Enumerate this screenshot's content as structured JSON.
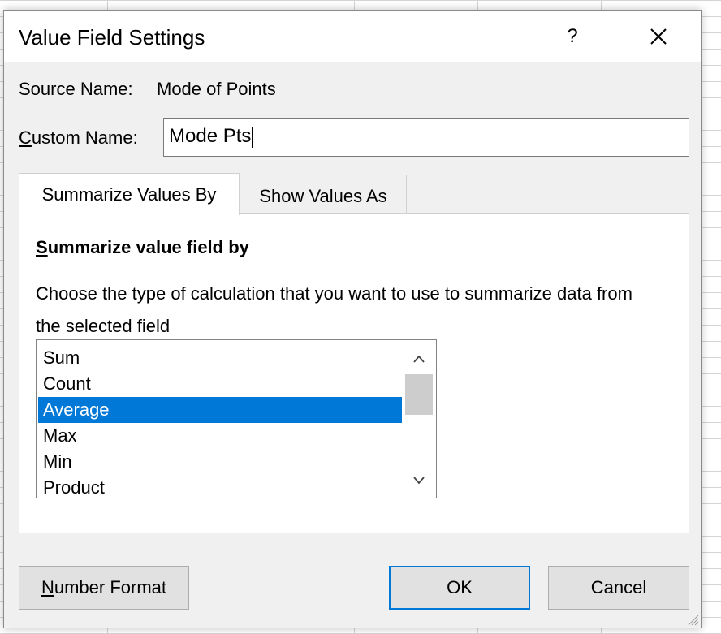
{
  "dialog": {
    "title": "Value Field Settings",
    "help_label": "?",
    "source_name_label": "Source Name:",
    "source_name_value": "Mode of Points",
    "custom_name_label_key": "C",
    "custom_name_label_rest": "ustom Name:",
    "custom_name_value": "Mode Pts"
  },
  "tabs": [
    {
      "label": "Summarize Values By",
      "active": true
    },
    {
      "label": "Show Values As",
      "active": false
    }
  ],
  "summarize": {
    "heading_key": "S",
    "heading_rest": "ummarize value field by",
    "description": "Choose the type of calculation that you want to use to summarize data from the selected field",
    "items": [
      "Sum",
      "Count",
      "Average",
      "Max",
      "Min",
      "Product"
    ],
    "selected_index": 2
  },
  "buttons": {
    "number_format_key": "N",
    "number_format_rest": "umber Format",
    "ok": "OK",
    "cancel": "Cancel"
  },
  "colors": {
    "selection": "#0078d7",
    "dialog_bg": "#f0f0f0"
  }
}
